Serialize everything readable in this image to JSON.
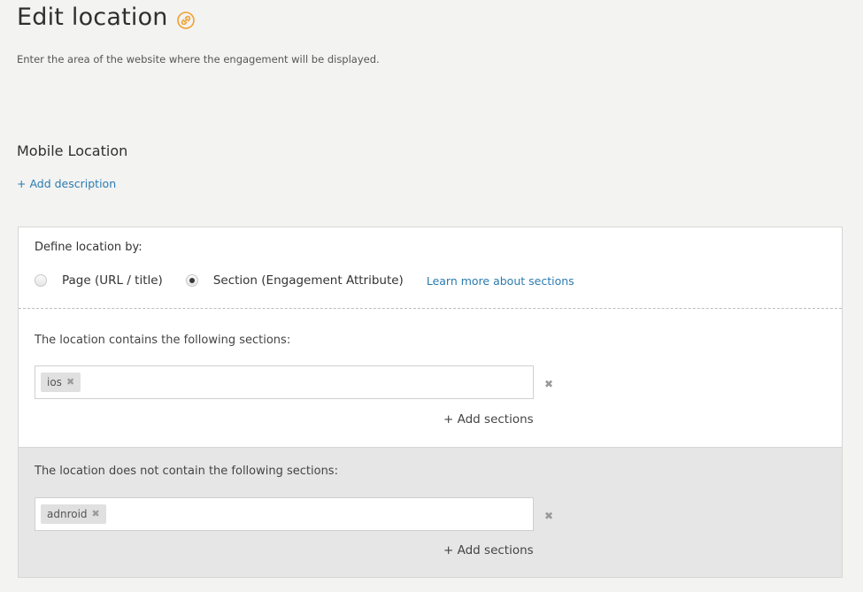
{
  "header": {
    "title": "Edit location",
    "subtitle": "Enter the area of the website where the engagement will be displayed.",
    "title_icon": "link-icon",
    "accent_color": "#f0a030"
  },
  "location": {
    "name": "Mobile Location",
    "add_description": "+ Add description"
  },
  "definition": {
    "label": "Define location by:",
    "options": [
      {
        "label": "Page (URL / title)",
        "checked": false
      },
      {
        "label": "Section (Engagement Attribute)",
        "checked": true
      }
    ],
    "learn_more": "Learn more about sections",
    "link_color": "#2b7bb0"
  },
  "includes": {
    "label": "The location contains the following sections:",
    "tags": [
      "ios"
    ],
    "add_label": "+ Add sections"
  },
  "excludes": {
    "label": "The location does not contain the following sections:",
    "tags": [
      "adnroid"
    ],
    "add_label": "+ Add sections"
  }
}
